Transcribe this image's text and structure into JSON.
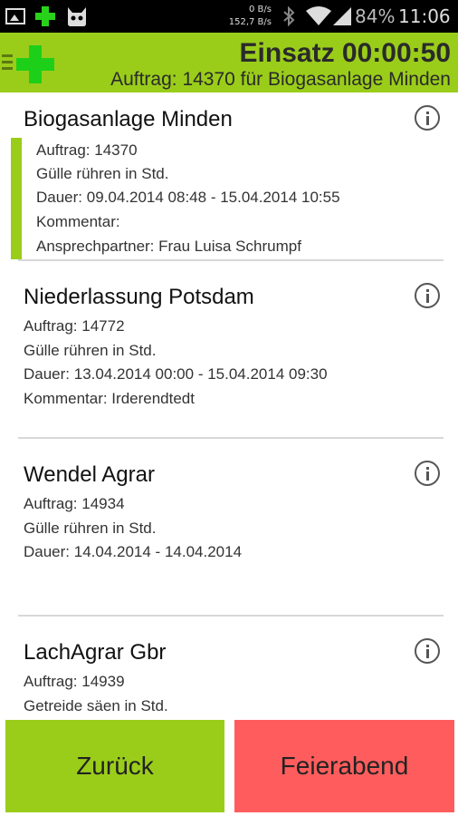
{
  "status_bar": {
    "net_down": "0 B/s",
    "net_up": "152,7 B/s",
    "battery": "84%",
    "time": "11:06",
    "icons": [
      "image-icon",
      "green-plus-icon",
      "cat-icon",
      "bluetooth-icon",
      "wifi-icon",
      "signal-icon"
    ]
  },
  "action_bar": {
    "title": "Einsatz 00:00:50",
    "subtitle": "Auftrag: 14370 für Biogasanlage Minden",
    "accent": "#9acd1a",
    "logo_color": "#1ecf1a"
  },
  "jobs": [
    {
      "name": "Biogasanlage Minden",
      "lines": [
        "Auftrag: 14370",
        "Gülle rühren in Std.",
        "Dauer: 09.04.2014 08:48 - 15.04.2014 10:55",
        "Kommentar:",
        "Ansprechpartner: Frau Luisa Schrumpf"
      ],
      "selected": true
    },
    {
      "name": "Niederlassung Potsdam",
      "lines": [
        "Auftrag: 14772",
        "Gülle rühren in Std.",
        "Dauer: 13.04.2014 00:00 - 15.04.2014 09:30",
        "Kommentar: Irderendtedt"
      ],
      "selected": false
    },
    {
      "name": "Wendel Agrar",
      "lines": [
        "Auftrag: 14934",
        "Gülle rühren in Std.",
        "Dauer: 14.04.2014 - 14.04.2014"
      ],
      "selected": false
    },
    {
      "name": "LachAgrar Gbr",
      "lines": [
        "Auftrag: 14939",
        "Getreide säen in Std."
      ],
      "selected": false
    }
  ],
  "buttons": {
    "back_label": "Zurück",
    "back_color": "#9acd1a",
    "end_label": "Feierabend",
    "end_color": "#ff5d5d"
  }
}
